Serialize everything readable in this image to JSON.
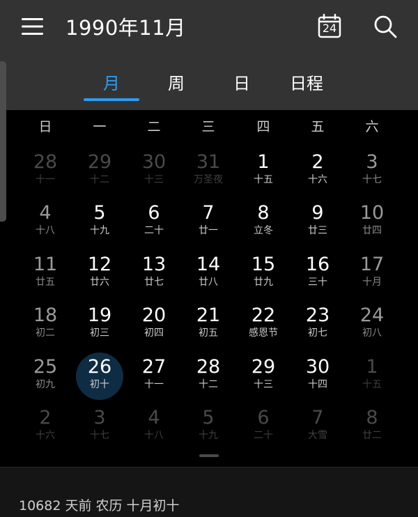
{
  "header": {
    "title": "1990年11月",
    "today_number": "24"
  },
  "tabs": [
    {
      "label": "月",
      "active": true
    },
    {
      "label": "周",
      "active": false
    },
    {
      "label": "日",
      "active": false
    },
    {
      "label": "日程",
      "active": false
    }
  ],
  "weekdays": [
    "日",
    "一",
    "二",
    "三",
    "四",
    "五",
    "六"
  ],
  "weeks": [
    [
      {
        "day": "28",
        "lunar": "十一",
        "other": true
      },
      {
        "day": "29",
        "lunar": "十二",
        "other": true
      },
      {
        "day": "30",
        "lunar": "十三",
        "other": true
      },
      {
        "day": "31",
        "lunar": "万圣夜",
        "other": true
      },
      {
        "day": "1",
        "lunar": "十五"
      },
      {
        "day": "2",
        "lunar": "十六"
      },
      {
        "day": "3",
        "lunar": "十七"
      }
    ],
    [
      {
        "day": "4",
        "lunar": "十八"
      },
      {
        "day": "5",
        "lunar": "十九"
      },
      {
        "day": "6",
        "lunar": "二十"
      },
      {
        "day": "7",
        "lunar": "廿一"
      },
      {
        "day": "8",
        "lunar": "立冬"
      },
      {
        "day": "9",
        "lunar": "廿三"
      },
      {
        "day": "10",
        "lunar": "廿四"
      }
    ],
    [
      {
        "day": "11",
        "lunar": "廿五"
      },
      {
        "day": "12",
        "lunar": "廿六"
      },
      {
        "day": "13",
        "lunar": "廿七"
      },
      {
        "day": "14",
        "lunar": "廿八"
      },
      {
        "day": "15",
        "lunar": "廿九"
      },
      {
        "day": "16",
        "lunar": "三十"
      },
      {
        "day": "17",
        "lunar": "十月"
      }
    ],
    [
      {
        "day": "18",
        "lunar": "初二"
      },
      {
        "day": "19",
        "lunar": "初三"
      },
      {
        "day": "20",
        "lunar": "初四"
      },
      {
        "day": "21",
        "lunar": "初五"
      },
      {
        "day": "22",
        "lunar": "感恩节"
      },
      {
        "day": "23",
        "lunar": "初七"
      },
      {
        "day": "24",
        "lunar": "初八"
      }
    ],
    [
      {
        "day": "25",
        "lunar": "初九"
      },
      {
        "day": "26",
        "lunar": "初十",
        "selected": true
      },
      {
        "day": "27",
        "lunar": "十一"
      },
      {
        "day": "28",
        "lunar": "十二"
      },
      {
        "day": "29",
        "lunar": "十三"
      },
      {
        "day": "30",
        "lunar": "十四"
      },
      {
        "day": "1",
        "lunar": "十五",
        "other": true
      }
    ],
    [
      {
        "day": "2",
        "lunar": "十六",
        "other": true
      },
      {
        "day": "3",
        "lunar": "十七",
        "other": true
      },
      {
        "day": "4",
        "lunar": "十八",
        "other": true
      },
      {
        "day": "5",
        "lunar": "十九",
        "other": true
      },
      {
        "day": "6",
        "lunar": "二十",
        "other": true
      },
      {
        "day": "7",
        "lunar": "大雪",
        "other": true
      },
      {
        "day": "8",
        "lunar": "廿二",
        "other": true
      }
    ]
  ],
  "info": {
    "text": "10682 天前  农历 十月初十"
  },
  "colors": {
    "header_bg": "#333333",
    "accent": "#2f9bf0",
    "selected_bg": "#0e2d44",
    "grid_bg": "#000000"
  },
  "icons": {
    "menu": "menu-icon",
    "today": "calendar-today-icon",
    "search": "search-icon"
  }
}
